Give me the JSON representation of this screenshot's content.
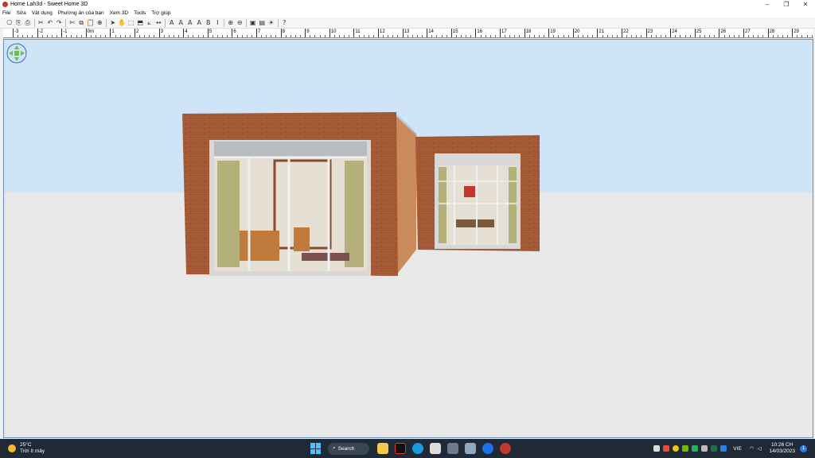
{
  "window": {
    "title": "Home Lah3d - Sweet Home 3D",
    "minimize": "–",
    "restore": "❐",
    "close": "✕"
  },
  "menu": [
    "File",
    "Sửa",
    "Vật dụng",
    "Phương án của bạn",
    "Xem 3D",
    "Tools",
    "Trợ giúp"
  ],
  "toolbar": {
    "icons": [
      "new-icon",
      "open-icon",
      "save-icon",
      "cut-icon",
      "undo-icon",
      "redo-icon",
      "cut2-icon",
      "copy-icon",
      "paste-icon",
      "add-furniture-icon",
      "select-icon",
      "pan-icon",
      "create-walls-icon",
      "create-rooms-icon",
      "create-polylines-icon",
      "create-dimensions-icon",
      "add-text-icon",
      "text-style-icon",
      "increase-text-icon",
      "decrease-text-icon",
      "bold-icon",
      "italic-icon",
      "zoom-in-icon",
      "zoom-out-icon",
      "create-photo-icon",
      "create-video-icon",
      "aerial-view-icon",
      "help-icon"
    ],
    "glyphs": [
      "⎔",
      "⎘",
      "⎙",
      "✂",
      "↶",
      "↷",
      "✄",
      "⧉",
      "📋",
      "⊕",
      "➤",
      "✋",
      "⬚",
      "⬒",
      "⟀",
      "↔",
      "A",
      "A",
      "A",
      "A",
      "B",
      "I",
      "⊕",
      "⊖",
      "▣",
      "▤",
      "☀",
      "?"
    ]
  },
  "ruler": {
    "labels": [
      "-3",
      "-2",
      "-1",
      "0m",
      "1",
      "2",
      "3",
      "4",
      "5",
      "6",
      "7",
      "8",
      "9",
      "10",
      "11",
      "12",
      "13",
      "14",
      "15",
      "16",
      "17",
      "18",
      "19",
      "20",
      "21",
      "22",
      "23",
      "24",
      "25",
      "26",
      "27",
      "28",
      "29"
    ]
  },
  "view3d": {
    "sky_color": "#cfe4f7",
    "ground_color": "#e8e8e8",
    "brick_color": "#a85c38",
    "side_color": "#c98a5c"
  },
  "taskbar": {
    "weather_temp": "25°C",
    "weather_desc": "Trời ít mây",
    "search_label": "Search",
    "language": "VIE",
    "time": "10:26 CH",
    "date": "14/03/2023",
    "notification_count": "1"
  }
}
